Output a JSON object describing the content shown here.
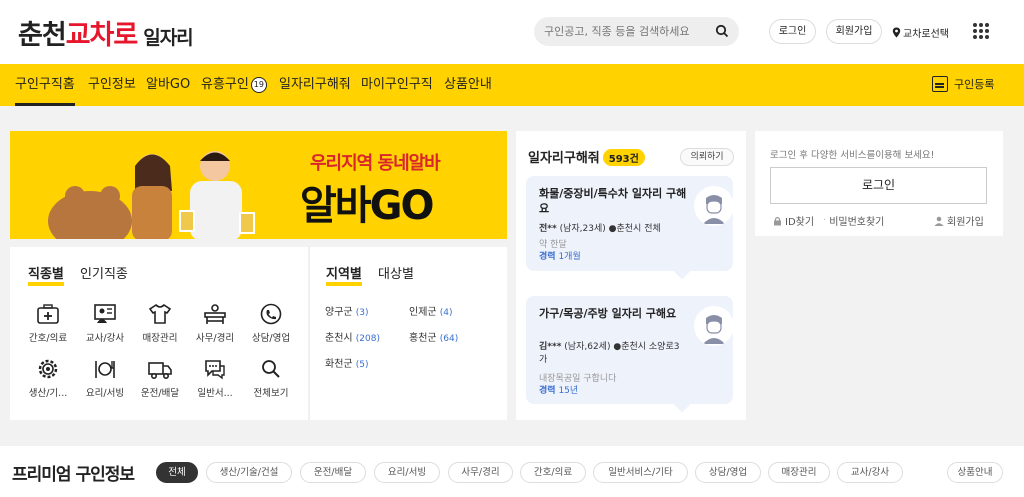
{
  "header": {
    "logo": {
      "part1": "춘천",
      "part2": "교차로",
      "part3": "일자리"
    },
    "search_placeholder": "구인공고, 직종 등을 검색하세요",
    "login": "로그인",
    "signup": "회원가입",
    "region_select": "교차로선택"
  },
  "nav": {
    "items": [
      "구인구직홈",
      "구인정보",
      "알바GO",
      "유흥구인",
      "일자리구해줘",
      "마이구인구직",
      "상품안내"
    ],
    "adult_badge": "19",
    "register": "구인등록"
  },
  "banner": {
    "line1": "우리지역 동네알바",
    "line2a": "알바",
    "line2b": "GO"
  },
  "categories": {
    "tabs": [
      "직종별",
      "인기직종"
    ],
    "items": [
      {
        "label": "간호/의료",
        "icon": "medical-kit-icon"
      },
      {
        "label": "교사/강사",
        "icon": "teacher-icon"
      },
      {
        "label": "매장관리",
        "icon": "shirt-icon"
      },
      {
        "label": "사무/경리",
        "icon": "office-icon"
      },
      {
        "label": "상담/영업",
        "icon": "phone-icon"
      },
      {
        "label": "생산/기...",
        "icon": "gear-icon"
      },
      {
        "label": "요리/서빙",
        "icon": "dining-icon"
      },
      {
        "label": "운전/배달",
        "icon": "truck-icon"
      },
      {
        "label": "일반서...",
        "icon": "chat-icon"
      },
      {
        "label": "전체보기",
        "icon": "search-icon"
      }
    ]
  },
  "regions": {
    "tabs": [
      "지역별",
      "대상별"
    ],
    "items": [
      {
        "name": "양구군",
        "count": "(3)"
      },
      {
        "name": "인제군",
        "count": "(4)"
      },
      {
        "name": "춘천시",
        "count": "(208)"
      },
      {
        "name": "홍천군",
        "count": "(64)"
      },
      {
        "name": "화천군",
        "count": "(5)"
      }
    ]
  },
  "help": {
    "title": "일자리구해줘",
    "count": "593건",
    "request": "의뢰하기",
    "cards": [
      {
        "title": "화물/중장비/특수차 일자리 구해요",
        "name": "전**",
        "info": "(남자,23세)",
        "loc": "춘천시 전체",
        "desc": "약 한달",
        "exp_label": "경력",
        "exp": "1개월"
      },
      {
        "title": "가구/목공/주방 일자리 구해요",
        "name": "김***",
        "info": "(남자,62세)",
        "loc": "춘천시 소양로3가",
        "desc": "내장목공일 구합니다",
        "exp_label": "경력",
        "exp": "15년"
      }
    ]
  },
  "login_box": {
    "message": "로그인 후 다양한 서비스를이용해 보세요!",
    "button": "로그인",
    "find_id": "ID찾기",
    "find_pw": "비밀번호찾기",
    "signup": "회원가입"
  },
  "premium": {
    "title": "프리미엄 구인정보",
    "chips": [
      "전체",
      "생산/기술/건설",
      "운전/배달",
      "요리/서빙",
      "사무/경리",
      "간호/의료",
      "일반서비스/기타",
      "상담/영업",
      "매장관리",
      "교사/강사"
    ],
    "product_info": "상품안내"
  },
  "colors": {
    "brand_yellow": "#ffd200",
    "brand_red": "#e6162d",
    "link_blue": "#3a6fd0"
  }
}
